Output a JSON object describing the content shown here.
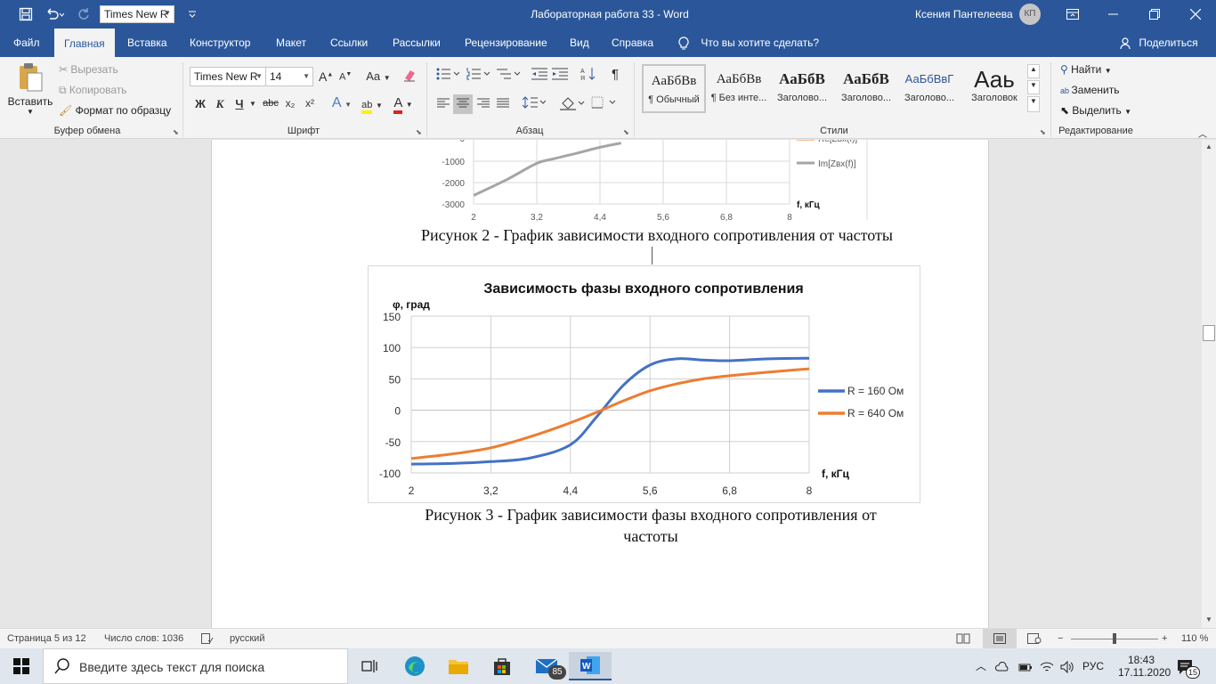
{
  "quick_access": {
    "save_icon": "save-icon",
    "undo_icon": "undo-icon",
    "redo_icon": "redo-icon",
    "font_value": "Times New R",
    "customize_icon": "customize-icon"
  },
  "window": {
    "title": "Лабораторная работа 33  -  Word",
    "user": "Ксения Пантелеева",
    "initials": "КП"
  },
  "tabs": [
    "Файл",
    "Главная",
    "Вставка",
    "Конструктор",
    "Макет",
    "Ссылки",
    "Рассылки",
    "Рецензирование",
    "Вид",
    "Справка"
  ],
  "active_tab": "Главная",
  "tell_me": "Что вы хотите сделать?",
  "share": "Поделиться",
  "ribbon": {
    "clipboard": {
      "label": "Буфер обмена",
      "paste": "Вставить",
      "cut": "Вырезать",
      "copy": "Копировать",
      "format_painter": "Формат по образцу"
    },
    "font": {
      "label": "Шрифт",
      "family": "Times New R",
      "size": "14",
      "grow": "A",
      "shrink": "A",
      "case": "Aa",
      "bold": "Ж",
      "italic": "К",
      "underline": "Ч",
      "strike": "abc",
      "sub": "x₂",
      "sup": "x²",
      "effects": "A",
      "highlight": "ab",
      "color": "A"
    },
    "paragraph": {
      "label": "Абзац",
      "pilcrow": "¶"
    },
    "styles": {
      "label": "Стили",
      "items": [
        {
          "sample": "АаБбВв",
          "name": "¶ Обычный"
        },
        {
          "sample": "АаБбВв",
          "name": "¶ Без инте..."
        },
        {
          "sample": "АаБбВ",
          "name": "Заголово..."
        },
        {
          "sample": "АаБбВ",
          "name": "Заголово..."
        },
        {
          "sample": "АаБбВвГ",
          "name": "Заголово..."
        },
        {
          "sample": "Ааь",
          "name": "Заголовок"
        }
      ]
    },
    "editing": {
      "label": "Редактирование",
      "find": "Найти",
      "replace": "Заменить",
      "select": "Выделить"
    }
  },
  "document": {
    "figure2_caption": "Рисунок 2 - График зависимости входного сопротивления от частоты",
    "figure3_caption_line1": "Рисунок 3 - График зависимости фазы входного сопротивления от",
    "figure3_caption_line2": "частоты"
  },
  "chart_data": [
    {
      "type": "line",
      "title": "",
      "partially_visible": true,
      "x_ticks": [
        "2",
        "3,2",
        "4,4",
        "5,6",
        "6,8",
        "8"
      ],
      "y_ticks": [
        "-1000",
        "-2000",
        "-3000"
      ],
      "xlabel": "f, кГц",
      "ylim": [
        -3000,
        0
      ],
      "xlim": [
        2,
        8
      ],
      "legend": [
        "Re[Zвх(f)]",
        "Im[Zвх(f)]"
      ],
      "series": [
        {
          "name": "Im[Zвх(f)]",
          "color": "#a5a5a5",
          "x": [
            2,
            2.6,
            3.2,
            3.5,
            4.0,
            4.4,
            4.8
          ],
          "y": [
            -2600,
            -1900,
            -1100,
            -900,
            -600,
            -350,
            -150
          ]
        }
      ]
    },
    {
      "type": "line",
      "title": "Зависимость фазы входного сопротивления",
      "ylabel": "φ, град",
      "xlabel": "f, кГц",
      "x_ticks": [
        "2",
        "3,2",
        "4,4",
        "5,6",
        "6,8",
        "8"
      ],
      "y_ticks": [
        "150",
        "100",
        "50",
        "0",
        "-50",
        "-100"
      ],
      "xlim": [
        2,
        8
      ],
      "ylim": [
        -100,
        150
      ],
      "grid": true,
      "legend_position": "right",
      "series": [
        {
          "name": "R = 160 Ом",
          "color": "#4472c4",
          "x": [
            2,
            2.6,
            3.2,
            3.8,
            4.4,
            4.8,
            5.2,
            5.6,
            6.0,
            6.4,
            6.8,
            7.4,
            8
          ],
          "y": [
            -86,
            -85,
            -82,
            -76,
            -55,
            -10,
            40,
            72,
            82,
            80,
            79,
            82,
            83
          ]
        },
        {
          "name": "R = 640 Ом",
          "color": "#ed7d31",
          "x": [
            2,
            2.6,
            3.2,
            3.8,
            4.4,
            4.8,
            5.2,
            5.6,
            6.0,
            6.4,
            6.8,
            7.4,
            8
          ],
          "y": [
            -77,
            -70,
            -60,
            -42,
            -20,
            -3,
            15,
            31,
            42,
            50,
            55,
            61,
            66
          ]
        }
      ]
    }
  ],
  "statusbar": {
    "page": "Страница 5 из 12",
    "words": "Число слов: 1036",
    "language": "русский",
    "zoom": "110 %"
  },
  "taskbar": {
    "search_placeholder": "Введите здесь текст для поиска",
    "mail_badge": "85",
    "language": "РУС",
    "time": "18:43",
    "date": "17.11.2020",
    "notifications": "15"
  }
}
